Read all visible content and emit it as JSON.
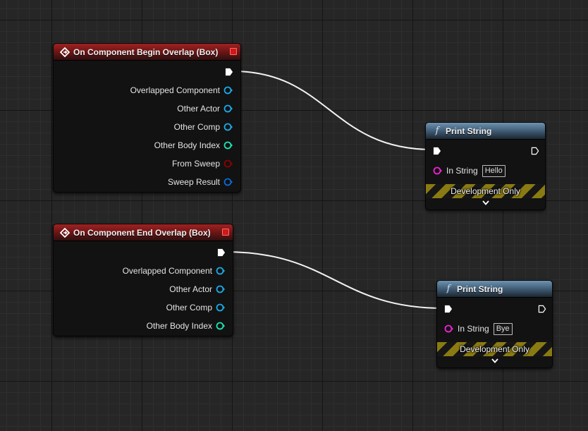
{
  "colors": {
    "exec": "#ffffff",
    "object_pin": "#1aa9e8",
    "int_pin": "#1fe3b0",
    "bool_pin": "#8b0000",
    "struct_pin": "#0a68d8",
    "string_pin": "#f021d4",
    "event_header": "#8a1c1c",
    "function_header": "#587a95",
    "dev_only_stripe": "#8a7a12"
  },
  "nodes": [
    {
      "kind": "event",
      "title": "On Component Begin Overlap (Box)",
      "icon": "event-diamond-icon",
      "output_pins": [
        {
          "label": "Overlapped Component",
          "type": "object_pin"
        },
        {
          "label": "Other Actor",
          "type": "object_pin"
        },
        {
          "label": "Other Comp",
          "type": "object_pin"
        },
        {
          "label": "Other Body Index",
          "type": "int_pin"
        },
        {
          "label": "From Sweep",
          "type": "bool_pin"
        },
        {
          "label": "Sweep Result",
          "type": "struct_pin"
        }
      ]
    },
    {
      "kind": "event",
      "title": "On Component End Overlap (Box)",
      "icon": "event-diamond-icon",
      "output_pins": [
        {
          "label": "Overlapped Component",
          "type": "object_pin"
        },
        {
          "label": "Other Actor",
          "type": "object_pin"
        },
        {
          "label": "Other Comp",
          "type": "object_pin"
        },
        {
          "label": "Other Body Index",
          "type": "int_pin"
        }
      ]
    },
    {
      "kind": "function",
      "title": "Print String",
      "icon": "function-f-icon",
      "icon_glyph": "f",
      "input_label": "In String",
      "input_value": "Hello",
      "footer": "Development Only",
      "expand_icon": "chevron-down-icon"
    },
    {
      "kind": "function",
      "title": "Print String",
      "icon": "function-f-icon",
      "icon_glyph": "f",
      "input_label": "In String",
      "input_value": "Bye",
      "footer": "Development Only",
      "expand_icon": "chevron-down-icon"
    }
  ]
}
